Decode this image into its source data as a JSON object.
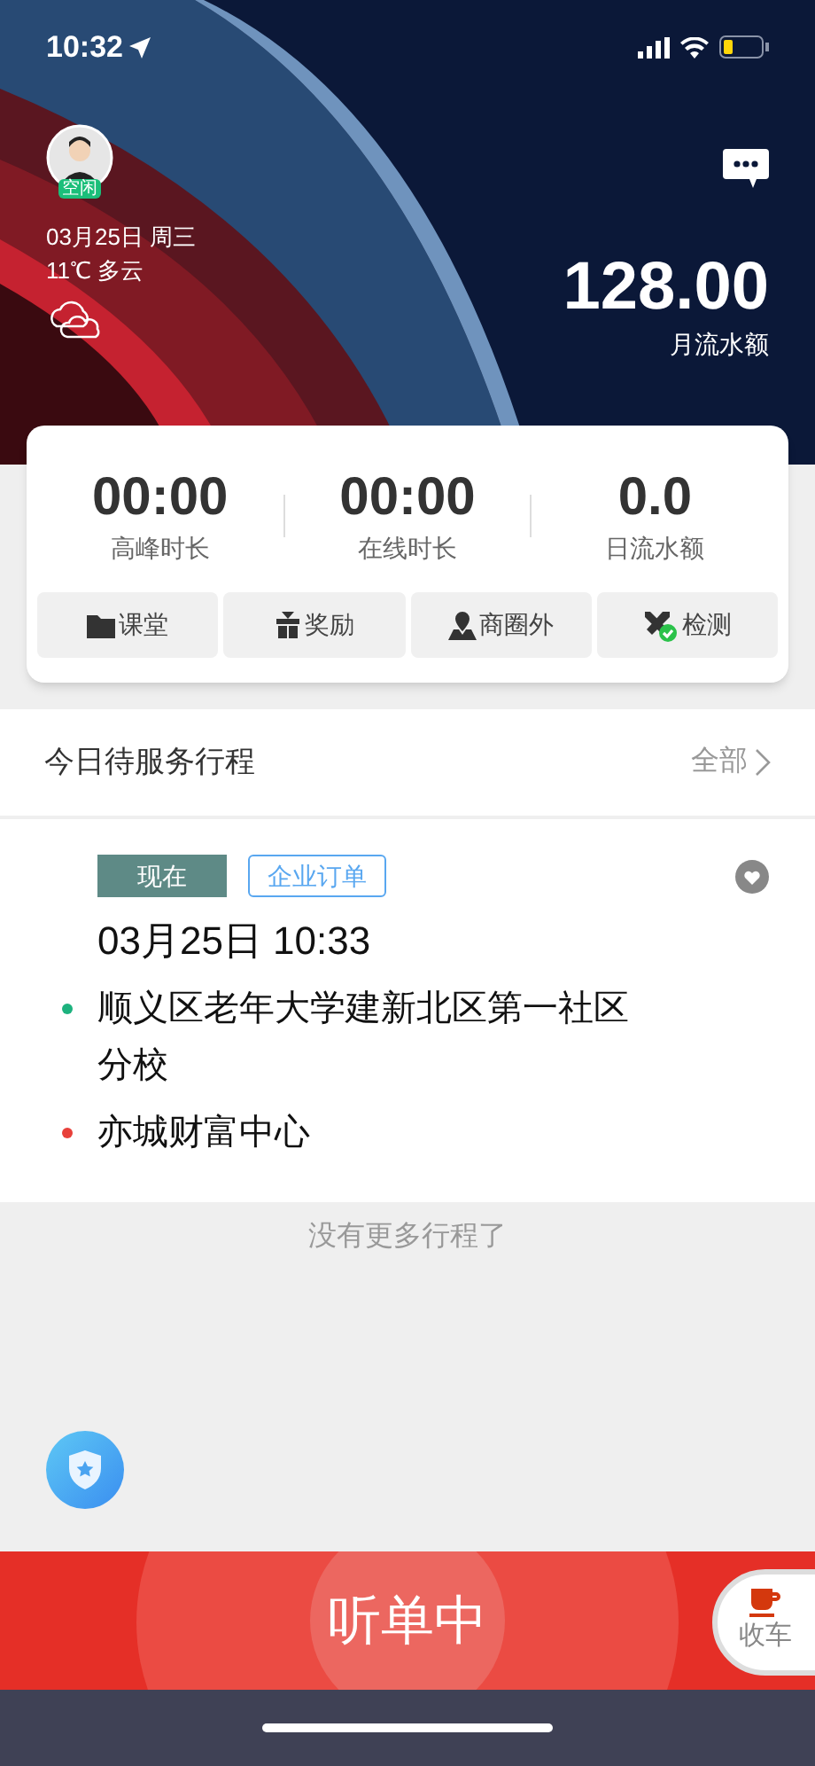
{
  "status_bar": {
    "time": "10:32"
  },
  "header": {
    "avatar_badge": "空闲",
    "date": "03月25日 周三",
    "weather": "11℃ 多云",
    "amount": "128.00",
    "amount_label": "月流水额"
  },
  "stats": [
    {
      "value": "00:00",
      "label": "高峰时长"
    },
    {
      "value": "00:00",
      "label": "在线时长"
    },
    {
      "value": "0.0",
      "label": "日流水额"
    }
  ],
  "shortcuts": [
    {
      "label": "课堂"
    },
    {
      "label": "奖励"
    },
    {
      "label": "商圈外"
    },
    {
      "label": "检测"
    }
  ],
  "trips_section": {
    "title": "今日待服务行程",
    "more": "全部"
  },
  "trip": {
    "tags": [
      {
        "label": "现在",
        "kind": "filled"
      },
      {
        "label": "企业订单",
        "kind": "outline"
      }
    ],
    "time": "03月25日 10:33",
    "stops": [
      {
        "address": "顺义区老年大学建新北区第一社区分校",
        "color": "#1db27e"
      },
      {
        "address": "亦城财富中心",
        "color": "#e8403a"
      }
    ]
  },
  "footer_note": "没有更多行程了",
  "listen_button": "听单中",
  "end_button": "收车"
}
